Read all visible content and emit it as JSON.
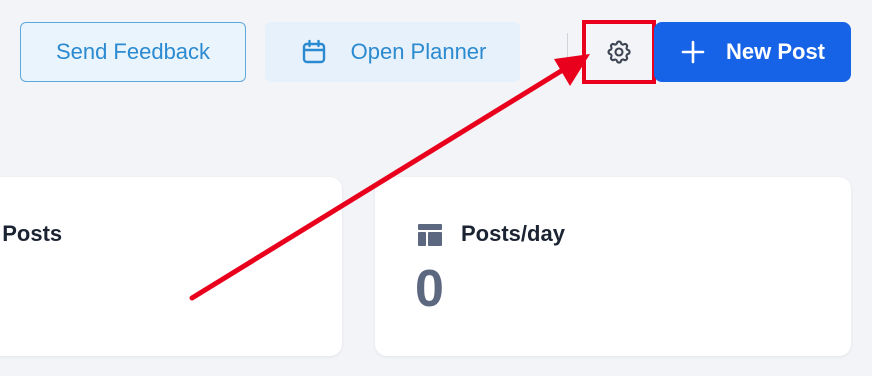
{
  "toolbar": {
    "feedback_label": "Send Feedback",
    "planner_label": "Open Planner",
    "planner_icon": "calendar-icon",
    "settings_icon": "gear-icon",
    "new_post_label": "New Post",
    "new_post_icon": "plus-icon"
  },
  "stats": [
    {
      "title": "l Posts",
      "value": ""
    },
    {
      "title": "Posts/day",
      "icon": "layout-icon",
      "value": "0"
    }
  ],
  "colors": {
    "accent": "#1663e8",
    "link_blue": "#2b8ad0",
    "highlight_red": "#e8001c",
    "background": "#f3f4f7"
  }
}
